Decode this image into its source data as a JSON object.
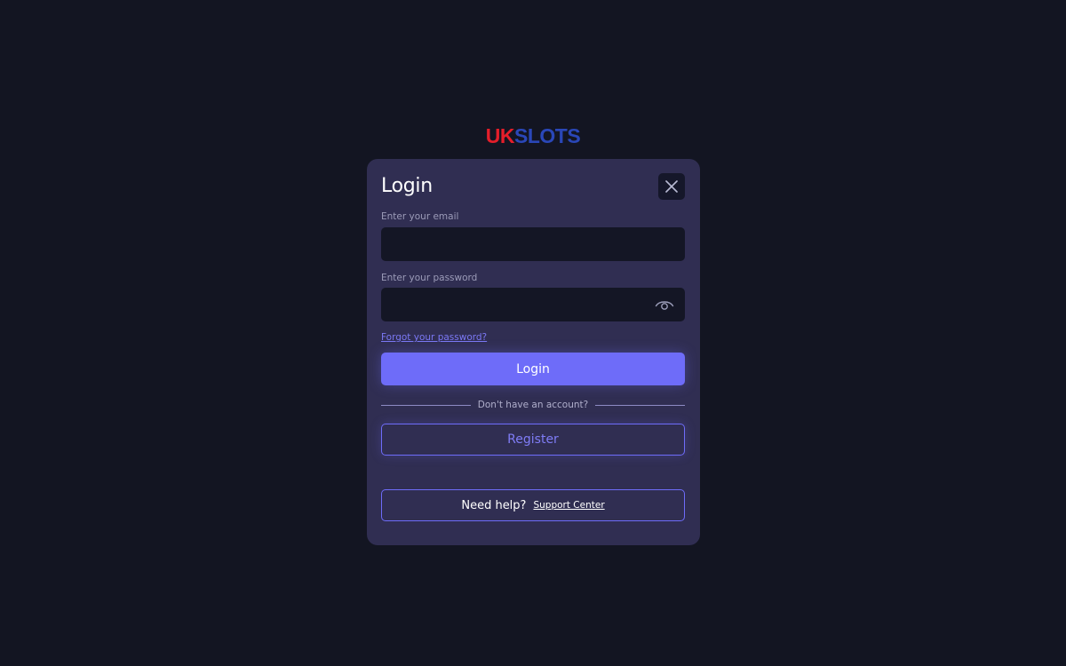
{
  "logo": {
    "part1": "UK",
    "part2": "SLOTS",
    "colors": {
      "uk": "#e51e2a",
      "slots": "#2a47b8"
    }
  },
  "modal": {
    "title": "Login",
    "close_icon": "close-icon",
    "email": {
      "label": "Enter your email",
      "value": "",
      "placeholder": ""
    },
    "password": {
      "label": "Enter your password",
      "value": "",
      "placeholder": "",
      "toggle_icon": "eye-icon"
    },
    "forgot_password": "Forgot your password?",
    "login_button": "Login",
    "divider_text": "Don't have an account?",
    "register_button": "Register",
    "help": {
      "text": "Need help?",
      "link": "Support Center"
    }
  },
  "colors": {
    "background": "#131522",
    "modal": "#302e52",
    "input": "#141625",
    "accent": "#6e6cf9"
  }
}
